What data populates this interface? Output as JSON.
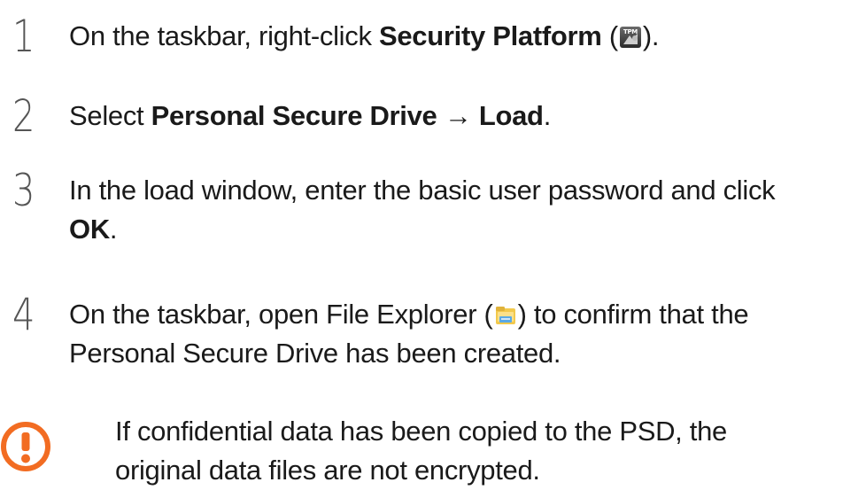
{
  "steps": [
    {
      "number": "1",
      "pre": "On the taskbar, right-click ",
      "bold": "Security Platform",
      "post_open": " (",
      "icon": "tpm-security-platform-icon",
      "post_close": ")."
    },
    {
      "number": "2",
      "pre": "Select ",
      "bold1": "Personal Secure Drive",
      "arrow": " → ",
      "bold2": "Load",
      "post": "."
    },
    {
      "number": "3",
      "line1": "In the load window, enter the basic user password and click",
      "bold": "OK",
      "post": "."
    },
    {
      "number": "4",
      "pre": "On the taskbar, open File Explorer (",
      "icon": "file-explorer-icon",
      "post1": ") to confirm that the",
      "line2": "Personal Secure Drive has been created."
    }
  ],
  "note": {
    "icon": "caution-icon",
    "line1": "If confidential data has been copied to the PSD, the",
    "line2": "original data files are not encrypted.",
    "icon_color": "#f26c22"
  }
}
